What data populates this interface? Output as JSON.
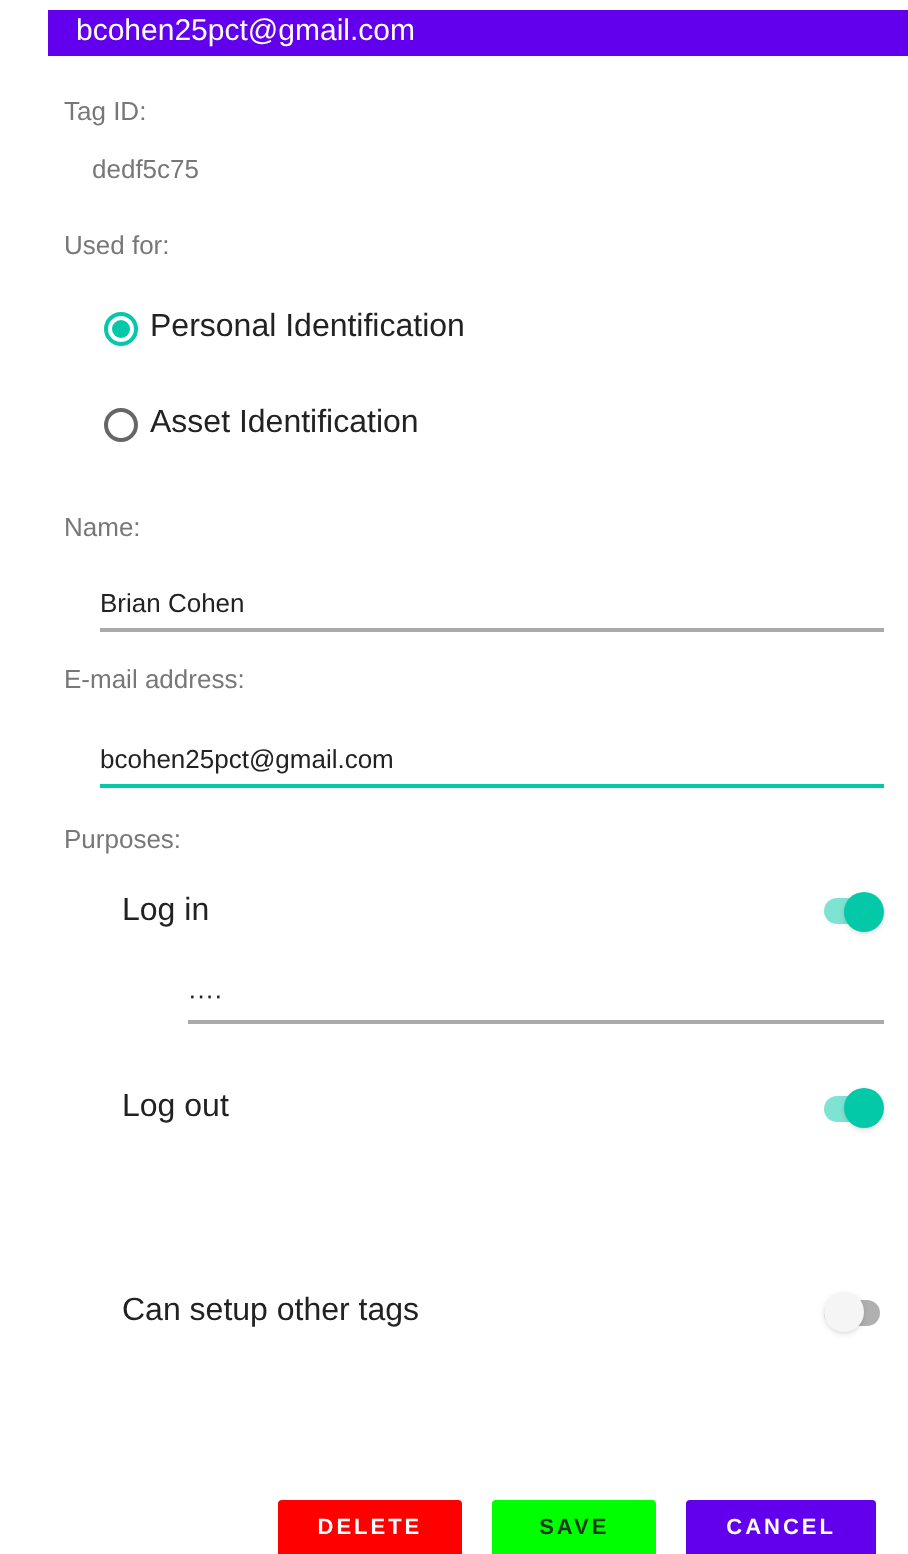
{
  "app_bar": {
    "title": "bcohen25pct@gmail.com"
  },
  "tag_id": {
    "label": "Tag ID:",
    "value": "dedf5c75"
  },
  "used_for": {
    "label": "Used for:",
    "options": [
      {
        "label": "Personal Identification",
        "selected": true
      },
      {
        "label": "Asset Identification",
        "selected": false
      }
    ]
  },
  "name": {
    "label": "Name:",
    "value": "Brian Cohen",
    "focused": false
  },
  "email": {
    "label": "E-mail address:",
    "value": "bcohen25pct@gmail.com",
    "focused": true
  },
  "purposes": {
    "label": "Purposes:",
    "items": [
      {
        "label": "Log in",
        "on": true,
        "password": "····"
      },
      {
        "label": "Log out",
        "on": true
      },
      {
        "label": "Can setup other tags",
        "on": false
      }
    ]
  },
  "buttons": [
    {
      "label": "DELETE",
      "color": "#ff0000"
    },
    {
      "label": "SAVE",
      "color": "#00ff00"
    },
    {
      "label": "CANCEL",
      "color": "#6200ee"
    }
  ]
}
